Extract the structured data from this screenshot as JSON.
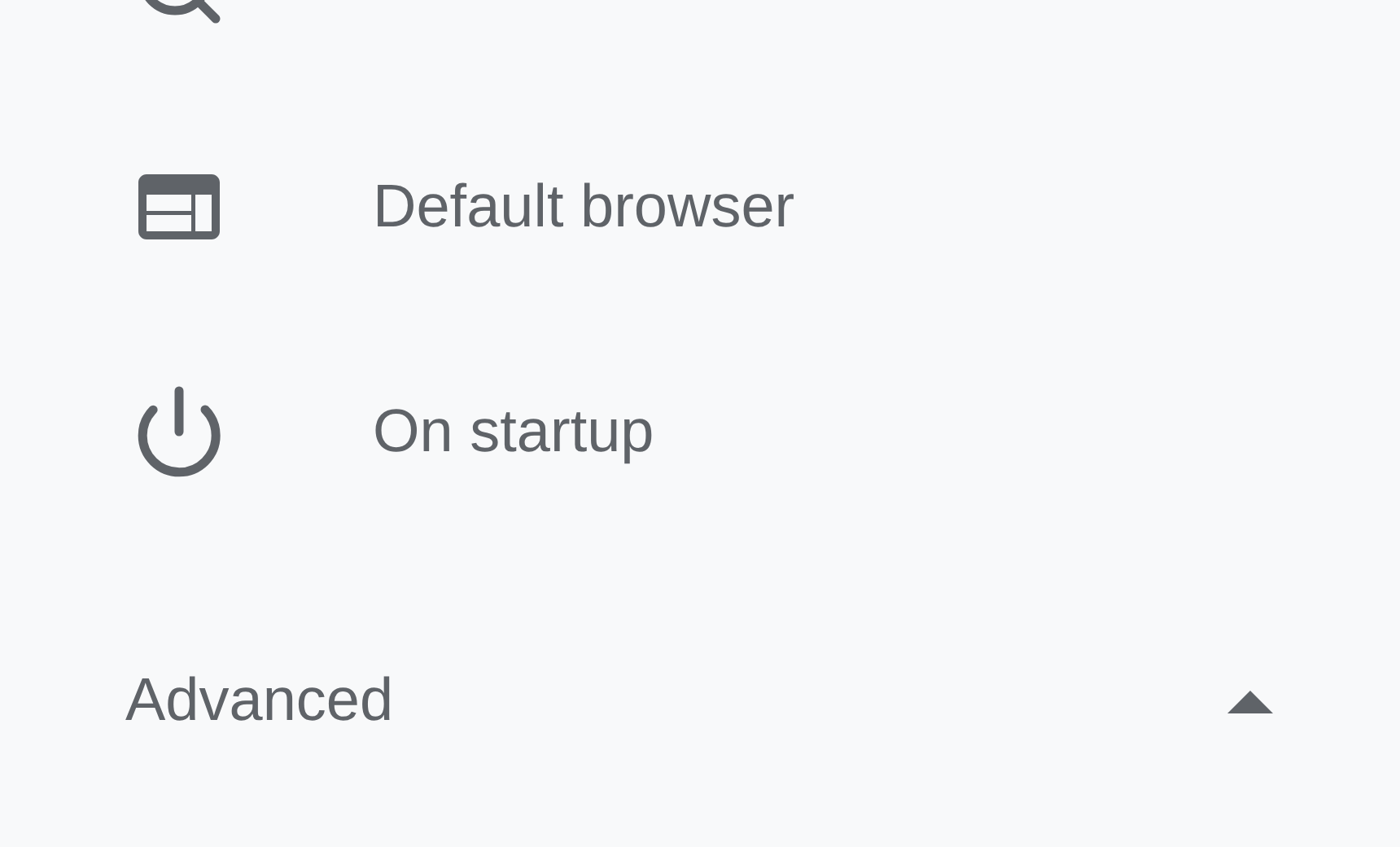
{
  "menu": {
    "items": [
      {
        "kind": "search"
      },
      {
        "kind": "browser",
        "label": "Default browser"
      },
      {
        "kind": "power",
        "label": "On startup"
      }
    ]
  },
  "advanced": {
    "label": "Advanced",
    "expanded": true
  }
}
